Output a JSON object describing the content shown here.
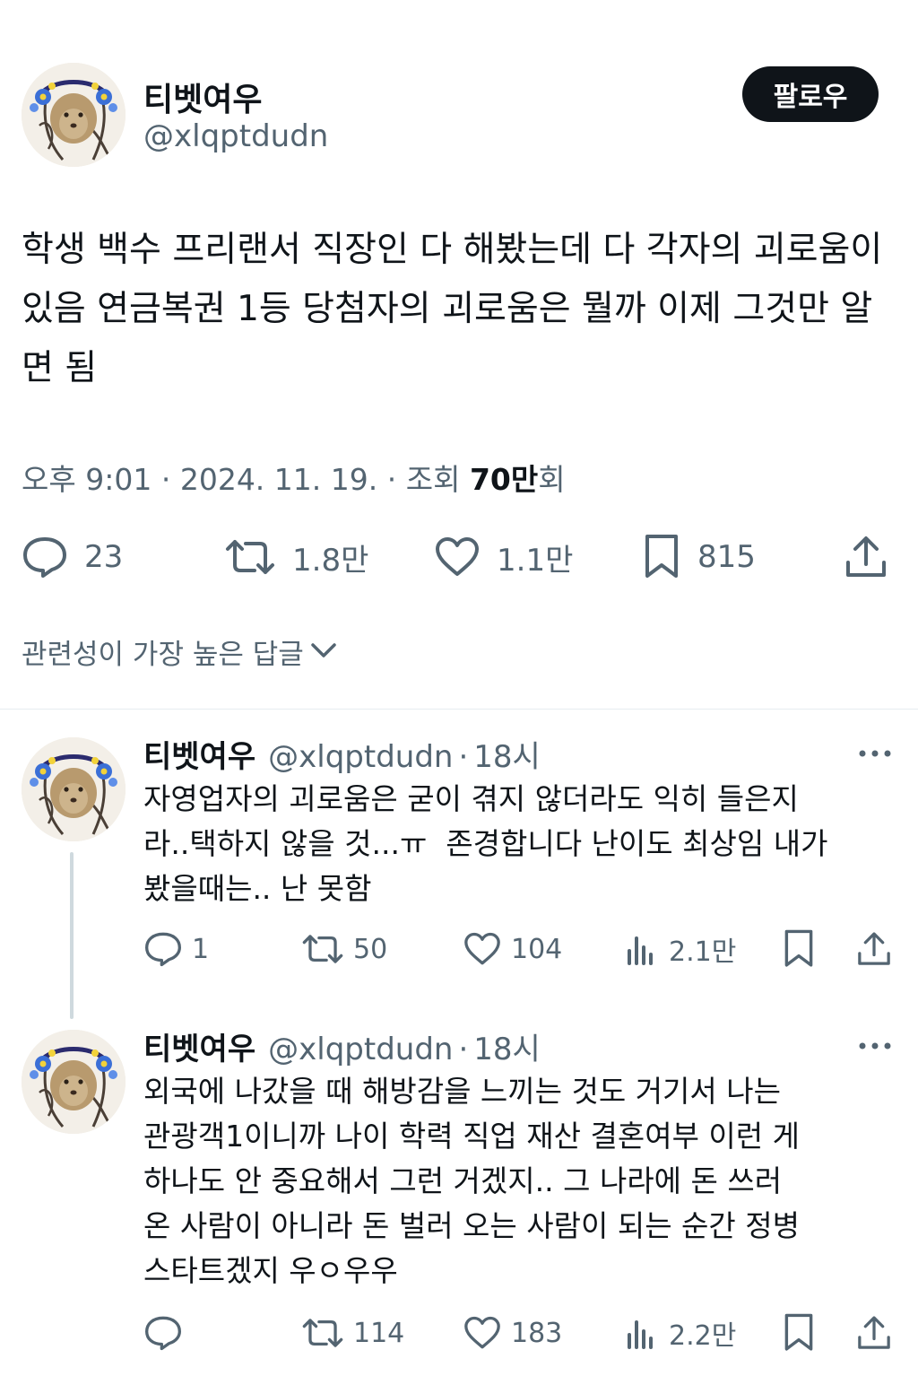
{
  "tweet": {
    "author": {
      "display_name": "티벳여우",
      "handle": "@xlqptdudn"
    },
    "follow_label": "팔로우",
    "text": "학생 백수 프리랜서 직장인 다 해봤는데 다 각자의 괴로움이 있음 연금복권 1등 당첨자의 괴로움은 뭘까 이제 그것만 알면 됨",
    "meta": {
      "time": "오후 9:01",
      "date": "2024. 11. 19.",
      "views_prefix": "· 조회",
      "views_count": "70만",
      "views_suffix": "회",
      "sep": "·"
    },
    "stats": {
      "replies": "23",
      "retweets": "1.8만",
      "likes": "1.1만",
      "bookmarks": "815"
    }
  },
  "sort_label": "관련성이 가장 높은 답글",
  "replies": [
    {
      "display_name": "티벳여우",
      "handle": "@xlqptdudn",
      "sep": "·",
      "time": "18시",
      "text": "자영업자의 괴로움은 굳이 겪지 않더라도 익히 들은지\n라..택하지 않을 것...ㅠ  존경합니다 난이도 최상임 내가\n봤을때는.. 난 못함",
      "stats": {
        "replies": "1",
        "retweets": "50",
        "likes": "104",
        "views": "2.1만"
      }
    },
    {
      "display_name": "티벳여우",
      "handle": "@xlqptdudn",
      "sep": "·",
      "time": "18시",
      "text": "외국에 나갔을 때 해방감을 느끼는 것도 거기서 나는\n관광객1이니까 나이 학력 직업 재산 결혼여부 이런 게\n하나도 안 중요해서 그런 거겠지.. 그 나라에 돈 쓰러\n온 사람이 아니라 돈 벌러 오는 사람이 되는 순간 정병\n스타트겠지 우ㅇ우우",
      "stats": {
        "replies": "",
        "retweets": "114",
        "likes": "183",
        "views": "2.2만"
      }
    }
  ],
  "colors": {
    "text": "#0f1419",
    "secondary": "#536471",
    "divider": "#e6ecf0",
    "thread": "#cfd9de",
    "button": "#0f1419"
  },
  "icons": [
    "reply-icon",
    "retweet-icon",
    "like-icon",
    "bookmark-icon",
    "share-icon",
    "views-icon",
    "chevron-down-icon",
    "more-icon"
  ]
}
